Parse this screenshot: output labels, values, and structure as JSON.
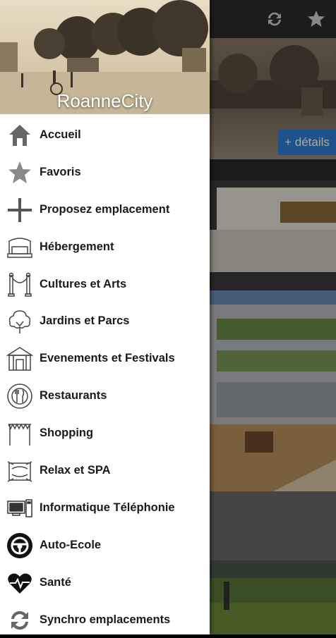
{
  "app": {
    "details_button": "+ détails",
    "toolbar_icons": [
      "sync-icon",
      "star-icon"
    ]
  },
  "drawer": {
    "title": "RoanneCity",
    "items": [
      {
        "label": "Accueil",
        "icon": "home-icon"
      },
      {
        "label": "Favoris",
        "icon": "star-icon"
      },
      {
        "label": "Proposez emplacement",
        "icon": "plus-icon"
      },
      {
        "label": "Hébergement",
        "icon": "bed-icon"
      },
      {
        "label": "Cultures et Arts",
        "icon": "museum-rope-icon"
      },
      {
        "label": "Jardins et Parcs",
        "icon": "tree-icon"
      },
      {
        "label": "Evenements et Festivals",
        "icon": "tent-icon"
      },
      {
        "label": "Restaurants",
        "icon": "cutlery-plate-icon"
      },
      {
        "label": "Shopping",
        "icon": "shop-awning-icon"
      },
      {
        "label": "Relax et SPA",
        "icon": "spa-icon"
      },
      {
        "label": "Informatique  Téléphonie",
        "icon": "computer-icon"
      },
      {
        "label": "Auto-Ecole",
        "icon": "steering-wheel-icon"
      },
      {
        "label": "Santé",
        "icon": "heart-pulse-icon"
      },
      {
        "label": "Synchro emplacements",
        "icon": "sync-icon"
      }
    ]
  }
}
